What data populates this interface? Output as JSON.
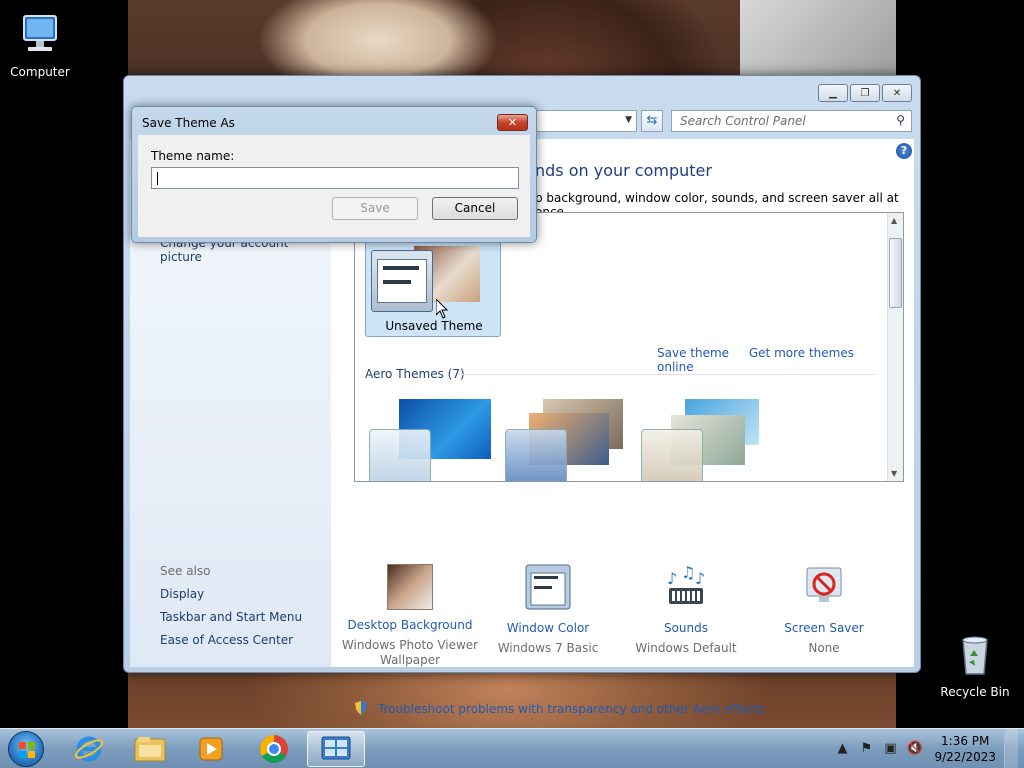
{
  "desktop": {
    "icons": [
      {
        "label": "Computer"
      },
      {
        "label": "Recycle Bin"
      }
    ]
  },
  "control_panel": {
    "search_placeholder": "Search Control Panel",
    "heading": "nds on your computer",
    "subheading": "p background, window color, sounds, and screen saver all at once.",
    "left_links": {
      "account_picture": "Change your account picture"
    },
    "see_also": {
      "header": "See also",
      "items": [
        "Display",
        "Taskbar and Start Menu",
        "Ease of Access Center"
      ]
    },
    "my_themes": {
      "unsaved_label": "Unsaved Theme",
      "save_link": "Save theme",
      "more_link": "Get more themes online"
    },
    "aero_header": "Aero Themes (7)",
    "bottom": [
      {
        "label": "Desktop Background",
        "sub": "Windows Photo Viewer Wallpaper"
      },
      {
        "label": "Window Color",
        "sub": "Windows 7 Basic"
      },
      {
        "label": "Sounds",
        "sub": "Windows Default"
      },
      {
        "label": "Screen Saver",
        "sub": "None"
      }
    ],
    "troubleshoot_link": "Troubleshoot problems with transparency and other Aero effects"
  },
  "dialog": {
    "title": "Save Theme As",
    "field_label": "Theme name:",
    "field_value": "",
    "save_label": "Save",
    "cancel_label": "Cancel"
  },
  "taskbar": {
    "time": "1:36 PM",
    "date": "9/22/2023"
  },
  "colors": {
    "link": "#1f5bb3",
    "heading": "#1e3e87"
  }
}
